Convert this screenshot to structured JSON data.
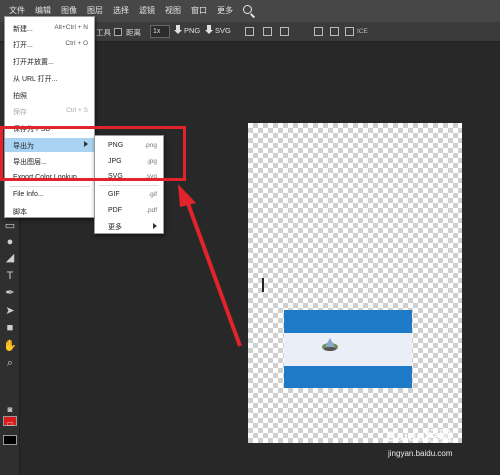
{
  "menubar": {
    "items": [
      "文件",
      "编辑",
      "图像",
      "图层",
      "选择",
      "滤镜",
      "视图",
      "窗口",
      "更多"
    ]
  },
  "options_bar": {
    "tool_label": "工具",
    "distance_label": "距离",
    "zoom_value": "1x",
    "export_png": "PNG",
    "export_svg": "SVG",
    "ice_label": "ICE"
  },
  "file_menu": {
    "items": [
      {
        "label": "新建...",
        "shortcut": "Alt+Ctrl + N"
      },
      {
        "label": "打开...",
        "shortcut": "Ctrl + O"
      },
      {
        "label": "打开并放置...",
        "shortcut": ""
      },
      {
        "label": "从 URL 打开...",
        "shortcut": ""
      },
      {
        "label": "拍照",
        "shortcut": ""
      },
      {
        "label": "保存",
        "shortcut": "Ctrl + S"
      },
      {
        "label": "保存为 PSD",
        "shortcut": ""
      },
      {
        "label": "导出为",
        "shortcut": ""
      },
      {
        "label": "导出图层...",
        "shortcut": ""
      },
      {
        "label": "Export Color Lookup...",
        "shortcut": ""
      },
      {
        "label": "File Info...",
        "shortcut": ""
      },
      {
        "label": "脚本",
        "shortcut": ""
      }
    ]
  },
  "export_submenu": {
    "items": [
      {
        "label": "PNG",
        "ext": ".png"
      },
      {
        "label": "JPG",
        "ext": ".jpg"
      },
      {
        "label": "SVG",
        "ext": ".svg"
      },
      {
        "label": "GIF",
        "ext": ".gif"
      },
      {
        "label": "PDF",
        "ext": ".pdf"
      },
      {
        "label": "更多",
        "ext": ""
      }
    ]
  },
  "colors": {
    "foreground": "#d91a1a",
    "background": "#000000",
    "annotation": "#e1242b",
    "highlight": "#aad3f3"
  },
  "watermark": {
    "brand": "Baidu经验",
    "url": "jingyan.baidu.com"
  }
}
